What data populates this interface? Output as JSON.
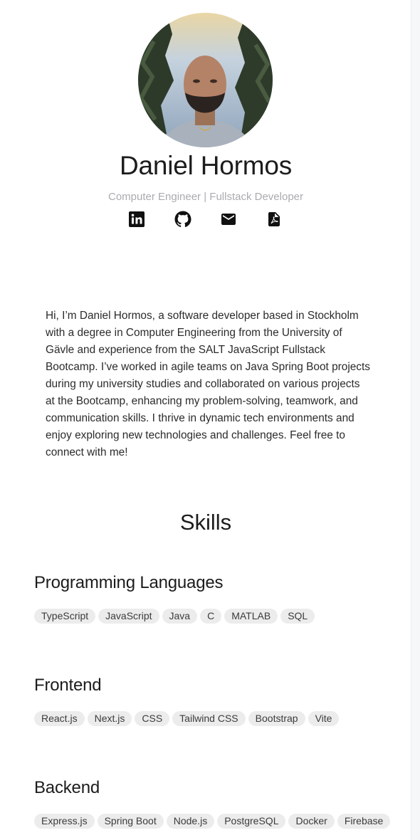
{
  "profile": {
    "name": "Daniel Hormos",
    "subtitle": "Computer Engineer | Fullstack Developer",
    "socials": [
      "linkedin-icon",
      "github-icon",
      "mail-icon",
      "pdf-icon"
    ]
  },
  "about": {
    "bio": "Hi, I’m Daniel Hormos, a software developer based in Stockholm with a degree in Computer Engineering from the University of Gävle and experience from the SALT JavaScript Fullstack Bootcamp. I’ve worked in agile teams on Java Spring Boot projects during my university studies and collaborated on various projects at the Bootcamp, enhancing my problem-solving, teamwork, and communication skills. I thrive in dynamic tech environments and enjoy exploring new technologies and challenges. Feel free to connect with me!"
  },
  "skills": {
    "title": "Skills",
    "groups": [
      {
        "title": "Programming Languages",
        "items": [
          "TypeScript",
          "JavaScript",
          "Java",
          "C",
          "MATLAB",
          "SQL"
        ]
      },
      {
        "title": "Frontend",
        "items": [
          "React.js",
          "Next.js",
          "CSS",
          "Tailwind CSS",
          "Bootstrap",
          "Vite"
        ]
      },
      {
        "title": "Backend",
        "items": [
          "Express.js",
          "Spring Boot",
          "Node.js",
          "PostgreSQL",
          "Docker",
          "Firebase"
        ]
      }
    ]
  },
  "colors": {
    "chip_bg": "#ececec",
    "subtitle": "#a9abaf",
    "text": "#1c1c1c"
  }
}
